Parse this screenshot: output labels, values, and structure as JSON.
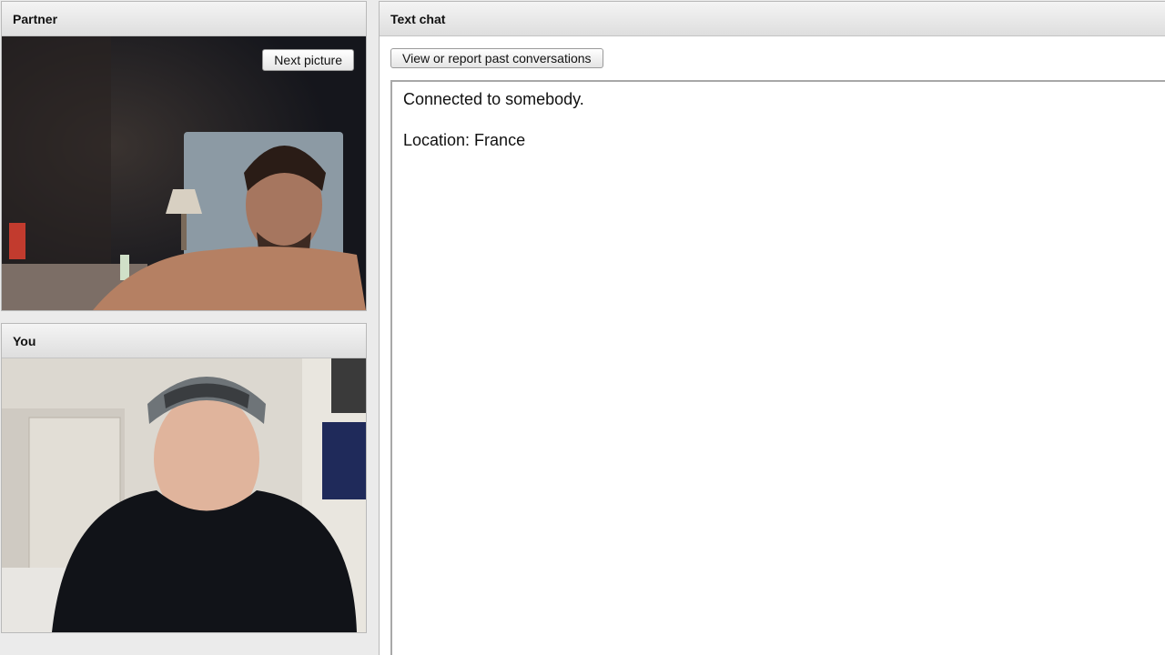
{
  "partner_panel": {
    "title": "Partner",
    "next_picture_label": "Next picture"
  },
  "you_panel": {
    "title": "You"
  },
  "chat_panel": {
    "title": "Text chat",
    "view_report_label": "View or report past conversations",
    "messages": [
      "Connected to somebody.",
      "Location: France"
    ]
  }
}
